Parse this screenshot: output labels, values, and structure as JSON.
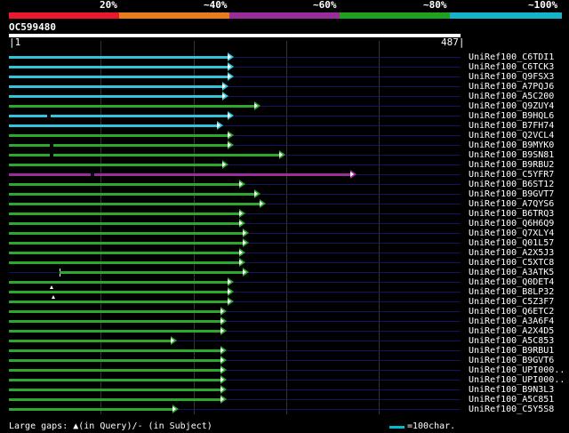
{
  "header": {
    "percent_labels": [
      "20%",
      "~40%",
      "~60%",
      "~80%",
      "~100%"
    ],
    "band_colors": [
      "#e8192c",
      "#e87c1a",
      "#9b2d9b",
      "#1fa31f",
      "#14b4c8"
    ]
  },
  "query": {
    "id": "OC599480",
    "start": "1",
    "end": "487",
    "length": 487
  },
  "colors": {
    "cyan": "#33c4dc",
    "green": "#2ca82c",
    "magenta": "#9b2d9b",
    "track": "#141466"
  },
  "hits": [
    {
      "name": "UniRef100_C6TDI1",
      "end": 240,
      "color": "cyan",
      "gap": null
    },
    {
      "name": "UniRef100_C6TCK3",
      "end": 240,
      "color": "cyan",
      "gap": null
    },
    {
      "name": "UniRef100_Q9FSX3",
      "end": 240,
      "color": "cyan",
      "gap": null
    },
    {
      "name": "UniRef100_A7PQJ6",
      "end": 234,
      "color": "cyan",
      "gap": null
    },
    {
      "name": "UniRef100_A5C200",
      "end": 234,
      "color": "cyan",
      "gap": null
    },
    {
      "name": "UniRef100_Q9ZUY4",
      "end": 268,
      "color": "green",
      "gap": null
    },
    {
      "name": "UniRef100_B9HQL6",
      "end": 240,
      "color": "cyan",
      "gap": "dash-41"
    },
    {
      "name": "UniRef100_B7FH74",
      "end": 228,
      "color": "cyan",
      "gap": null
    },
    {
      "name": "UniRef100_Q2VCL4",
      "end": 240,
      "color": "green",
      "gap": null
    },
    {
      "name": "UniRef100_B9MYK0",
      "end": 240,
      "color": "green",
      "gap": "dash-44"
    },
    {
      "name": "UniRef100_B9SN81",
      "end": 295,
      "color": "green",
      "gap": "dash-44"
    },
    {
      "name": "UniRef100_B9RBU2",
      "end": 234,
      "color": "green",
      "gap": null
    },
    {
      "name": "UniRef100_C5YFR7",
      "end": 372,
      "color": "magenta",
      "gap": "dash-88"
    },
    {
      "name": "UniRef100_B6ST12",
      "end": 252,
      "color": "green",
      "gap": null
    },
    {
      "name": "UniRef100_B9GVT7",
      "end": 268,
      "color": "green",
      "gap": null
    },
    {
      "name": "UniRef100_A7QYS6",
      "end": 274,
      "color": "green",
      "gap": null
    },
    {
      "name": "UniRef100_B6TRQ3",
      "end": 252,
      "color": "green",
      "gap": null
    },
    {
      "name": "UniRef100_Q6H6Q9",
      "end": 252,
      "color": "green",
      "gap": null
    },
    {
      "name": "UniRef100_Q7XLY4",
      "end": 256,
      "color": "green",
      "gap": null
    },
    {
      "name": "UniRef100_Q01L57",
      "end": 256,
      "color": "green",
      "gap": null
    },
    {
      "name": "UniRef100_A2X5J3",
      "end": 252,
      "color": "green",
      "gap": null
    },
    {
      "name": "UniRef100_C5XTC8",
      "end": 252,
      "color": "green",
      "gap": null
    },
    {
      "name": "UniRef100_A3ATK5",
      "end": 256,
      "color": "green",
      "gap": "start-55"
    },
    {
      "name": "UniRef100_Q0DET4",
      "end": 240,
      "color": "green",
      "gap": null
    },
    {
      "name": "UniRef100_B8LP32",
      "end": 240,
      "color": "green",
      "gap": "caret-44"
    },
    {
      "name": "UniRef100_C5Z3F7",
      "end": 240,
      "color": "green",
      "gap": "caret-46"
    },
    {
      "name": "UniRef100_Q6ETC2",
      "end": 232,
      "color": "green",
      "gap": null
    },
    {
      "name": "UniRef100_A3A6F4",
      "end": 232,
      "color": "green",
      "gap": null
    },
    {
      "name": "UniRef100_A2X4D5",
      "end": 232,
      "color": "green",
      "gap": null
    },
    {
      "name": "UniRef100_A5C853",
      "end": 178,
      "color": "green",
      "gap": null
    },
    {
      "name": "UniRef100_B9RBU1",
      "end": 232,
      "color": "green",
      "gap": null
    },
    {
      "name": "UniRef100_B9GVT6",
      "end": 232,
      "color": "green",
      "gap": null
    },
    {
      "name": "UniRef100_UPI000..",
      "end": 232,
      "color": "green",
      "gap": null
    },
    {
      "name": "UniRef100_UPI000..",
      "end": 232,
      "color": "green",
      "gap": null
    },
    {
      "name": "UniRef100_B9N3L3",
      "end": 232,
      "color": "green",
      "gap": null
    },
    {
      "name": "UniRef100_A5C851",
      "end": 232,
      "color": "green",
      "gap": null
    },
    {
      "name": "UniRef100_C5Y5S8",
      "end": 180,
      "color": "green",
      "gap": null
    }
  ],
  "footer": {
    "legend": "Large gaps: ▲(in Query)/- (in Subject)",
    "scale": "=100char."
  }
}
